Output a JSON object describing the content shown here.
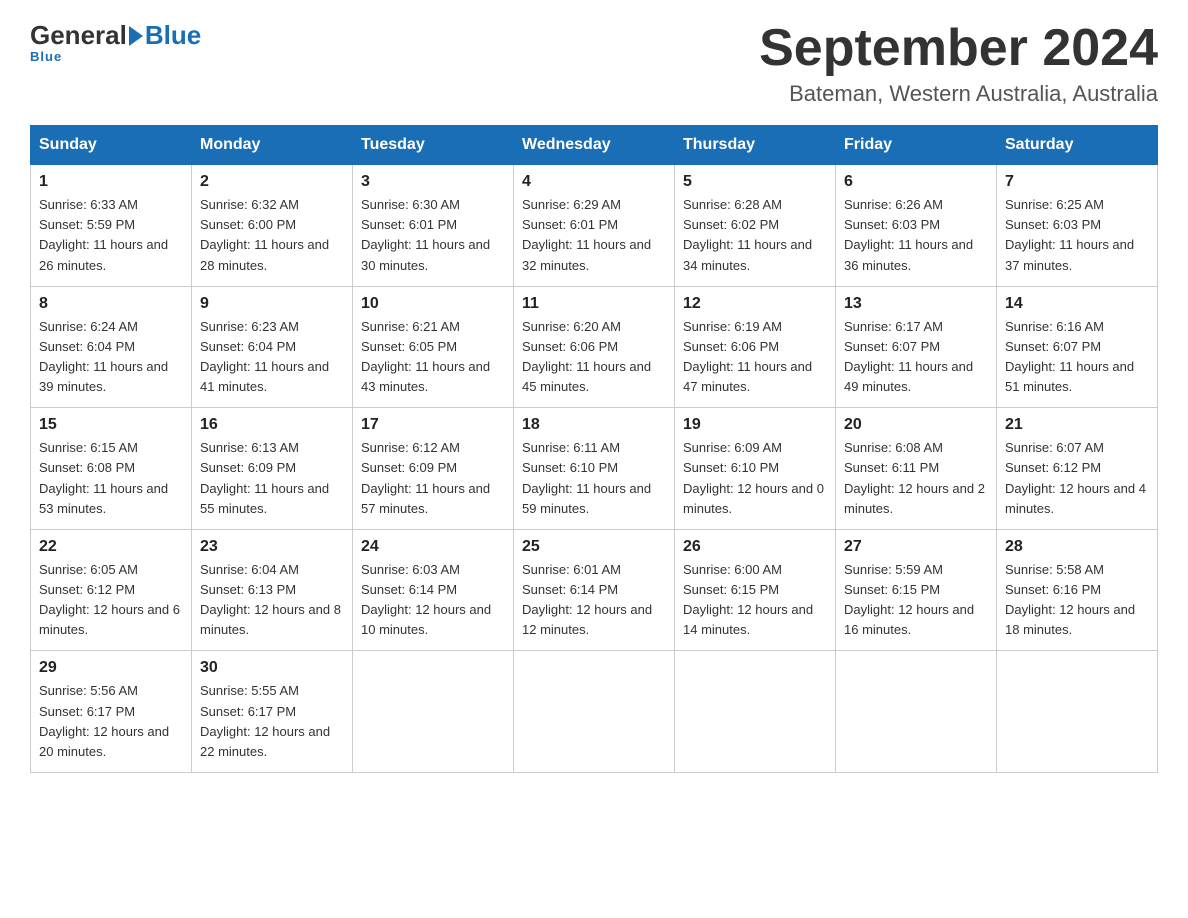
{
  "logo": {
    "general": "General",
    "blue": "Blue",
    "underline": "Blue"
  },
  "title": "September 2024",
  "subtitle": "Bateman, Western Australia, Australia",
  "weekdays": [
    "Sunday",
    "Monday",
    "Tuesday",
    "Wednesday",
    "Thursday",
    "Friday",
    "Saturday"
  ],
  "weeks": [
    [
      {
        "day": "1",
        "sunrise": "6:33 AM",
        "sunset": "5:59 PM",
        "daylight": "11 hours and 26 minutes."
      },
      {
        "day": "2",
        "sunrise": "6:32 AM",
        "sunset": "6:00 PM",
        "daylight": "11 hours and 28 minutes."
      },
      {
        "day": "3",
        "sunrise": "6:30 AM",
        "sunset": "6:01 PM",
        "daylight": "11 hours and 30 minutes."
      },
      {
        "day": "4",
        "sunrise": "6:29 AM",
        "sunset": "6:01 PM",
        "daylight": "11 hours and 32 minutes."
      },
      {
        "day": "5",
        "sunrise": "6:28 AM",
        "sunset": "6:02 PM",
        "daylight": "11 hours and 34 minutes."
      },
      {
        "day": "6",
        "sunrise": "6:26 AM",
        "sunset": "6:03 PM",
        "daylight": "11 hours and 36 minutes."
      },
      {
        "day": "7",
        "sunrise": "6:25 AM",
        "sunset": "6:03 PM",
        "daylight": "11 hours and 37 minutes."
      }
    ],
    [
      {
        "day": "8",
        "sunrise": "6:24 AM",
        "sunset": "6:04 PM",
        "daylight": "11 hours and 39 minutes."
      },
      {
        "day": "9",
        "sunrise": "6:23 AM",
        "sunset": "6:04 PM",
        "daylight": "11 hours and 41 minutes."
      },
      {
        "day": "10",
        "sunrise": "6:21 AM",
        "sunset": "6:05 PM",
        "daylight": "11 hours and 43 minutes."
      },
      {
        "day": "11",
        "sunrise": "6:20 AM",
        "sunset": "6:06 PM",
        "daylight": "11 hours and 45 minutes."
      },
      {
        "day": "12",
        "sunrise": "6:19 AM",
        "sunset": "6:06 PM",
        "daylight": "11 hours and 47 minutes."
      },
      {
        "day": "13",
        "sunrise": "6:17 AM",
        "sunset": "6:07 PM",
        "daylight": "11 hours and 49 minutes."
      },
      {
        "day": "14",
        "sunrise": "6:16 AM",
        "sunset": "6:07 PM",
        "daylight": "11 hours and 51 minutes."
      }
    ],
    [
      {
        "day": "15",
        "sunrise": "6:15 AM",
        "sunset": "6:08 PM",
        "daylight": "11 hours and 53 minutes."
      },
      {
        "day": "16",
        "sunrise": "6:13 AM",
        "sunset": "6:09 PM",
        "daylight": "11 hours and 55 minutes."
      },
      {
        "day": "17",
        "sunrise": "6:12 AM",
        "sunset": "6:09 PM",
        "daylight": "11 hours and 57 minutes."
      },
      {
        "day": "18",
        "sunrise": "6:11 AM",
        "sunset": "6:10 PM",
        "daylight": "11 hours and 59 minutes."
      },
      {
        "day": "19",
        "sunrise": "6:09 AM",
        "sunset": "6:10 PM",
        "daylight": "12 hours and 0 minutes."
      },
      {
        "day": "20",
        "sunrise": "6:08 AM",
        "sunset": "6:11 PM",
        "daylight": "12 hours and 2 minutes."
      },
      {
        "day": "21",
        "sunrise": "6:07 AM",
        "sunset": "6:12 PM",
        "daylight": "12 hours and 4 minutes."
      }
    ],
    [
      {
        "day": "22",
        "sunrise": "6:05 AM",
        "sunset": "6:12 PM",
        "daylight": "12 hours and 6 minutes."
      },
      {
        "day": "23",
        "sunrise": "6:04 AM",
        "sunset": "6:13 PM",
        "daylight": "12 hours and 8 minutes."
      },
      {
        "day": "24",
        "sunrise": "6:03 AM",
        "sunset": "6:14 PM",
        "daylight": "12 hours and 10 minutes."
      },
      {
        "day": "25",
        "sunrise": "6:01 AM",
        "sunset": "6:14 PM",
        "daylight": "12 hours and 12 minutes."
      },
      {
        "day": "26",
        "sunrise": "6:00 AM",
        "sunset": "6:15 PM",
        "daylight": "12 hours and 14 minutes."
      },
      {
        "day": "27",
        "sunrise": "5:59 AM",
        "sunset": "6:15 PM",
        "daylight": "12 hours and 16 minutes."
      },
      {
        "day": "28",
        "sunrise": "5:58 AM",
        "sunset": "6:16 PM",
        "daylight": "12 hours and 18 minutes."
      }
    ],
    [
      {
        "day": "29",
        "sunrise": "5:56 AM",
        "sunset": "6:17 PM",
        "daylight": "12 hours and 20 minutes."
      },
      {
        "day": "30",
        "sunrise": "5:55 AM",
        "sunset": "6:17 PM",
        "daylight": "12 hours and 22 minutes."
      },
      null,
      null,
      null,
      null,
      null
    ]
  ],
  "labels": {
    "sunrise": "Sunrise:",
    "sunset": "Sunset:",
    "daylight": "Daylight:"
  }
}
